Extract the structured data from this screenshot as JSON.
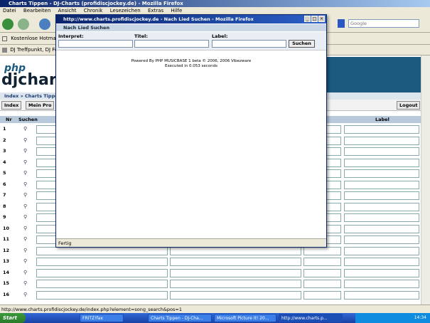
{
  "window": {
    "title": "Charts Tippen - DJ-Charts (profidiscjockey.de) - Mozilla Firefox"
  },
  "menu": [
    "Datei",
    "Bearbeiten",
    "Ansicht",
    "Chronik",
    "Lesezeichen",
    "Extras",
    "Hilfe"
  ],
  "search": {
    "placeholder": "Google"
  },
  "bookmarks": {
    "item1": "Kostenlose Hotmail",
    "item2": "DJ Treffpunkt, DJ Forum"
  },
  "site": {
    "logo_top": "php",
    "logo_main": "djchar",
    "breadcrumb": "Index » Charts Tippe",
    "buttons": {
      "index": "Index",
      "profile": "Mein Pro",
      "logout": "Logout"
    },
    "table_headers": {
      "nr": "Nr",
      "suchen": "Suchen",
      "label": "Label"
    },
    "rows": [
      "1",
      "2",
      "3",
      "4",
      "5",
      "6",
      "7",
      "8",
      "9",
      "10",
      "11",
      "12",
      "13",
      "14",
      "15",
      "16"
    ]
  },
  "popup": {
    "title": "http://www.charts.profidiscjockey.de - Nach Lied Suchen - Mozilla Firefox",
    "header": "Nach Lied Suchen",
    "labels": {
      "interpret": "Interpret:",
      "titel": "Titel:",
      "label": "Label:"
    },
    "search_button": "Suchen",
    "powered": "Powered By PHP MUSICBASE 1 beta © 2006, 2006 Vibezware",
    "executed": "Executed in 0.053 seconds",
    "status": "Fertig"
  },
  "statusbar": {
    "text": "http://www.charts.profidiscjockey.de/index.php?element=song_search&pos=1"
  },
  "taskbar": {
    "start": "Start",
    "tasks": [
      "FRITZ!fax",
      "Charts Tippen - DJ-Cha...",
      "Microsoft Picture It! 20...",
      "http://www.charts.p..."
    ],
    "clock": "14:34"
  },
  "colors": {
    "brand": "#1c5a80",
    "titlebar": "#0a246a"
  }
}
